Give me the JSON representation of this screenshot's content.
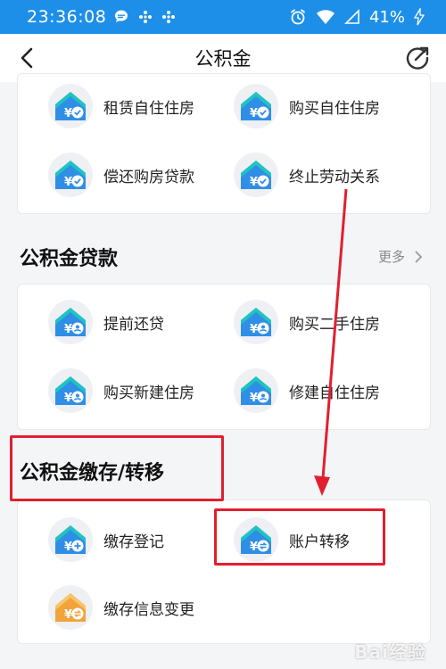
{
  "status_bar": {
    "time": "23:36:08",
    "battery": "41%"
  },
  "nav": {
    "title": "公积金"
  },
  "sections": {
    "extract": {
      "items": [
        {
          "label": "租赁自住住房"
        },
        {
          "label": "购买自住住房"
        },
        {
          "label": "偿还购房贷款"
        },
        {
          "label": "终止劳动关系"
        }
      ]
    },
    "loan": {
      "title": "公积金贷款",
      "more": "更多",
      "items": [
        {
          "label": "提前还贷"
        },
        {
          "label": "购买二手住房"
        },
        {
          "label": "购买新建住房"
        },
        {
          "label": "修建自住住房"
        }
      ]
    },
    "deposit": {
      "title": "公积金缴存/转移",
      "items": [
        {
          "label": "缴存登记"
        },
        {
          "label": "账户转移"
        },
        {
          "label": "缴存信息变更"
        }
      ]
    }
  },
  "colors": {
    "status_bar": "#1d8fe8",
    "accent_blue": "#2f8ee6",
    "accent_teal": "#1fc4c0",
    "accent_orange": "#f2a33a",
    "annotation_red": "#e21f2f"
  },
  "watermark": "Bai经验"
}
